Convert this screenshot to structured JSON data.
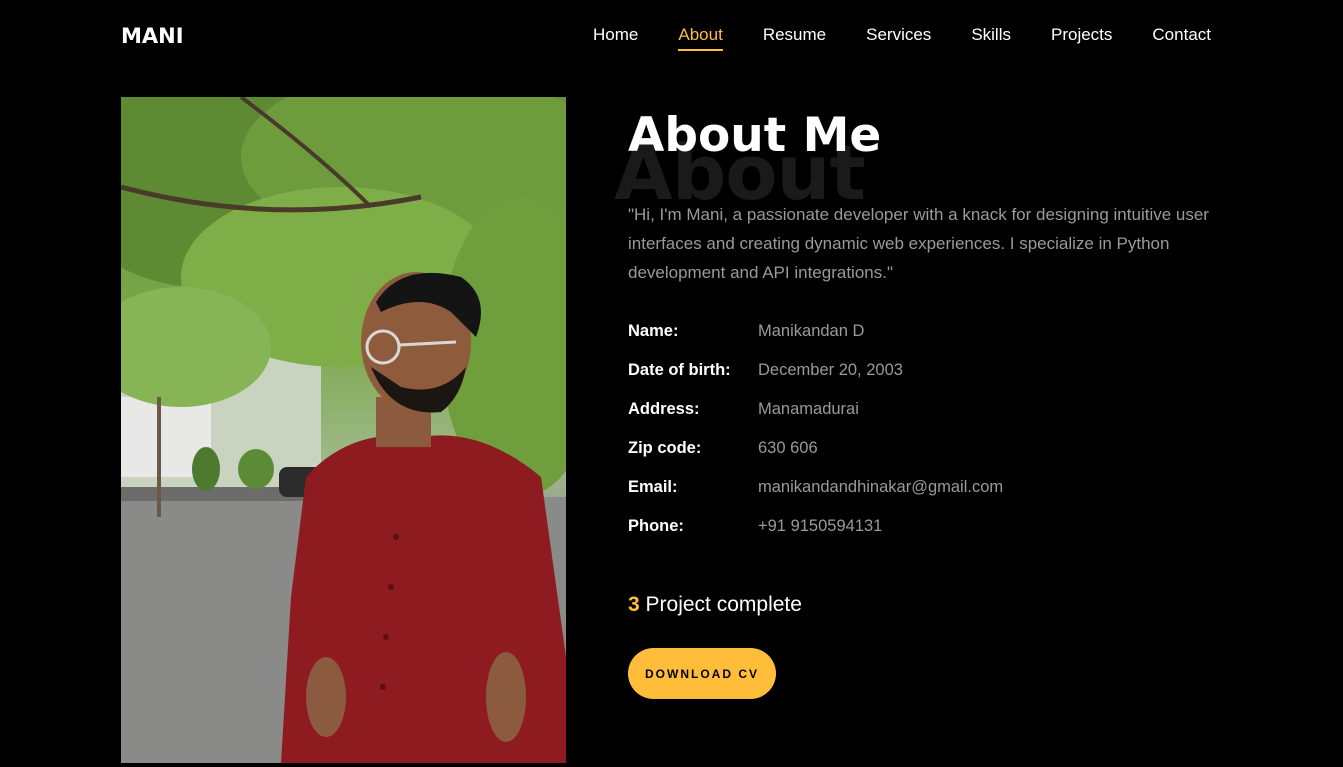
{
  "brand": "MANI",
  "nav": {
    "items": [
      {
        "label": "Home",
        "active": false
      },
      {
        "label": "About",
        "active": true
      },
      {
        "label": "Resume",
        "active": false
      },
      {
        "label": "Services",
        "active": false
      },
      {
        "label": "Skills",
        "active": false
      },
      {
        "label": "Projects",
        "active": false
      },
      {
        "label": "Contact",
        "active": false
      }
    ]
  },
  "about": {
    "bg_heading": "About",
    "heading": "About Me",
    "bio": "\"Hi, I'm Mani, a passionate developer with a knack for designing intuitive user interfaces and creating dynamic web experiences. I specialize in Python development and API integrations.\"",
    "info": [
      {
        "label": "Name:",
        "value": "Manikandan D"
      },
      {
        "label": "Date of birth:",
        "value": "December 20, 2003"
      },
      {
        "label": "Address:",
        "value": "Manamadurai"
      },
      {
        "label": "Zip code:",
        "value": "630 606"
      },
      {
        "label": "Email:",
        "value": "manikandandhinakar@gmail.com"
      },
      {
        "label": "Phone:",
        "value": "+91 9150594131"
      }
    ],
    "counter": {
      "number": "3",
      "label": " Project complete"
    },
    "download_label": "DOWNLOAD CV"
  },
  "colors": {
    "accent": "#ffbd39",
    "background": "#000000",
    "muted_text": "#9a9a9a"
  }
}
